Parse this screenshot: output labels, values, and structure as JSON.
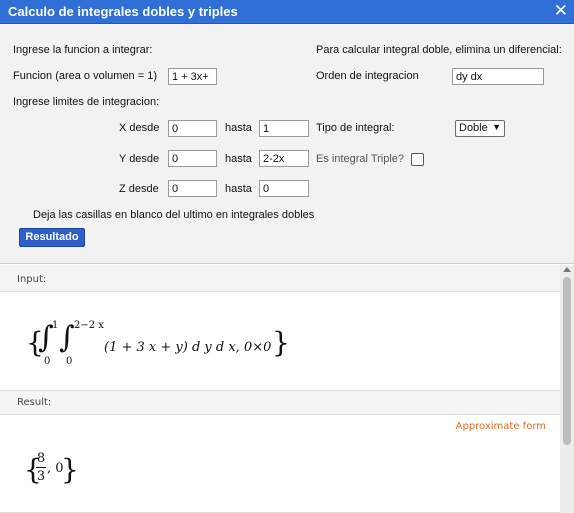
{
  "window": {
    "title": "Calculo de integrales dobles y triples",
    "close_glyph": "✕"
  },
  "form": {
    "ingrese_funcion": "Ingrese la funcion a integrar:",
    "nota_doble": "Para calcular integral doble, elimina un diferencial:",
    "funcion_label": "Funcion (area o volumen = 1)",
    "funcion_value": "1 + 3x+",
    "orden_label": "Orden de integracion",
    "orden_value": "dy dx",
    "limites_label": "Ingrese limites de integracion:",
    "x_desde_label": "X desde",
    "x_desde": "0",
    "x_hasta_label": "hasta",
    "x_hasta": "1",
    "y_desde_label": "Y desde",
    "y_desde": "0",
    "y_hasta_label": "hasta",
    "y_hasta": "2-2x",
    "z_desde_label": "Z desde",
    "z_desde": "0",
    "z_hasta_label": "hasta",
    "z_hasta": "0",
    "tipo_label": "Tipo de integral:",
    "tipo_value": "Doble",
    "triple_label": "Es integral Triple?",
    "triple_checked": false,
    "nota_blanco": "Deja las casillas en blanco del ultimo en integrales dobles",
    "submit_label": "Resultado"
  },
  "results": {
    "input_header": "Input:",
    "input_math": {
      "open": "{",
      "lower_outer": "0",
      "upper_outer": "1",
      "lower_inner": "0",
      "upper_inner": "2−2 x",
      "integrand": "(1 + 3 x + y) d y d x, 0×0",
      "close": "}"
    },
    "result_header": "Result:",
    "approximate_link": "Approximate form",
    "result_math": {
      "numerator": "8",
      "denominator": "3",
      "rest": ", 0"
    }
  },
  "colors": {
    "titlebar": "#2f6fd6",
    "button": "#2e5fc7",
    "link": "#e26a22"
  }
}
